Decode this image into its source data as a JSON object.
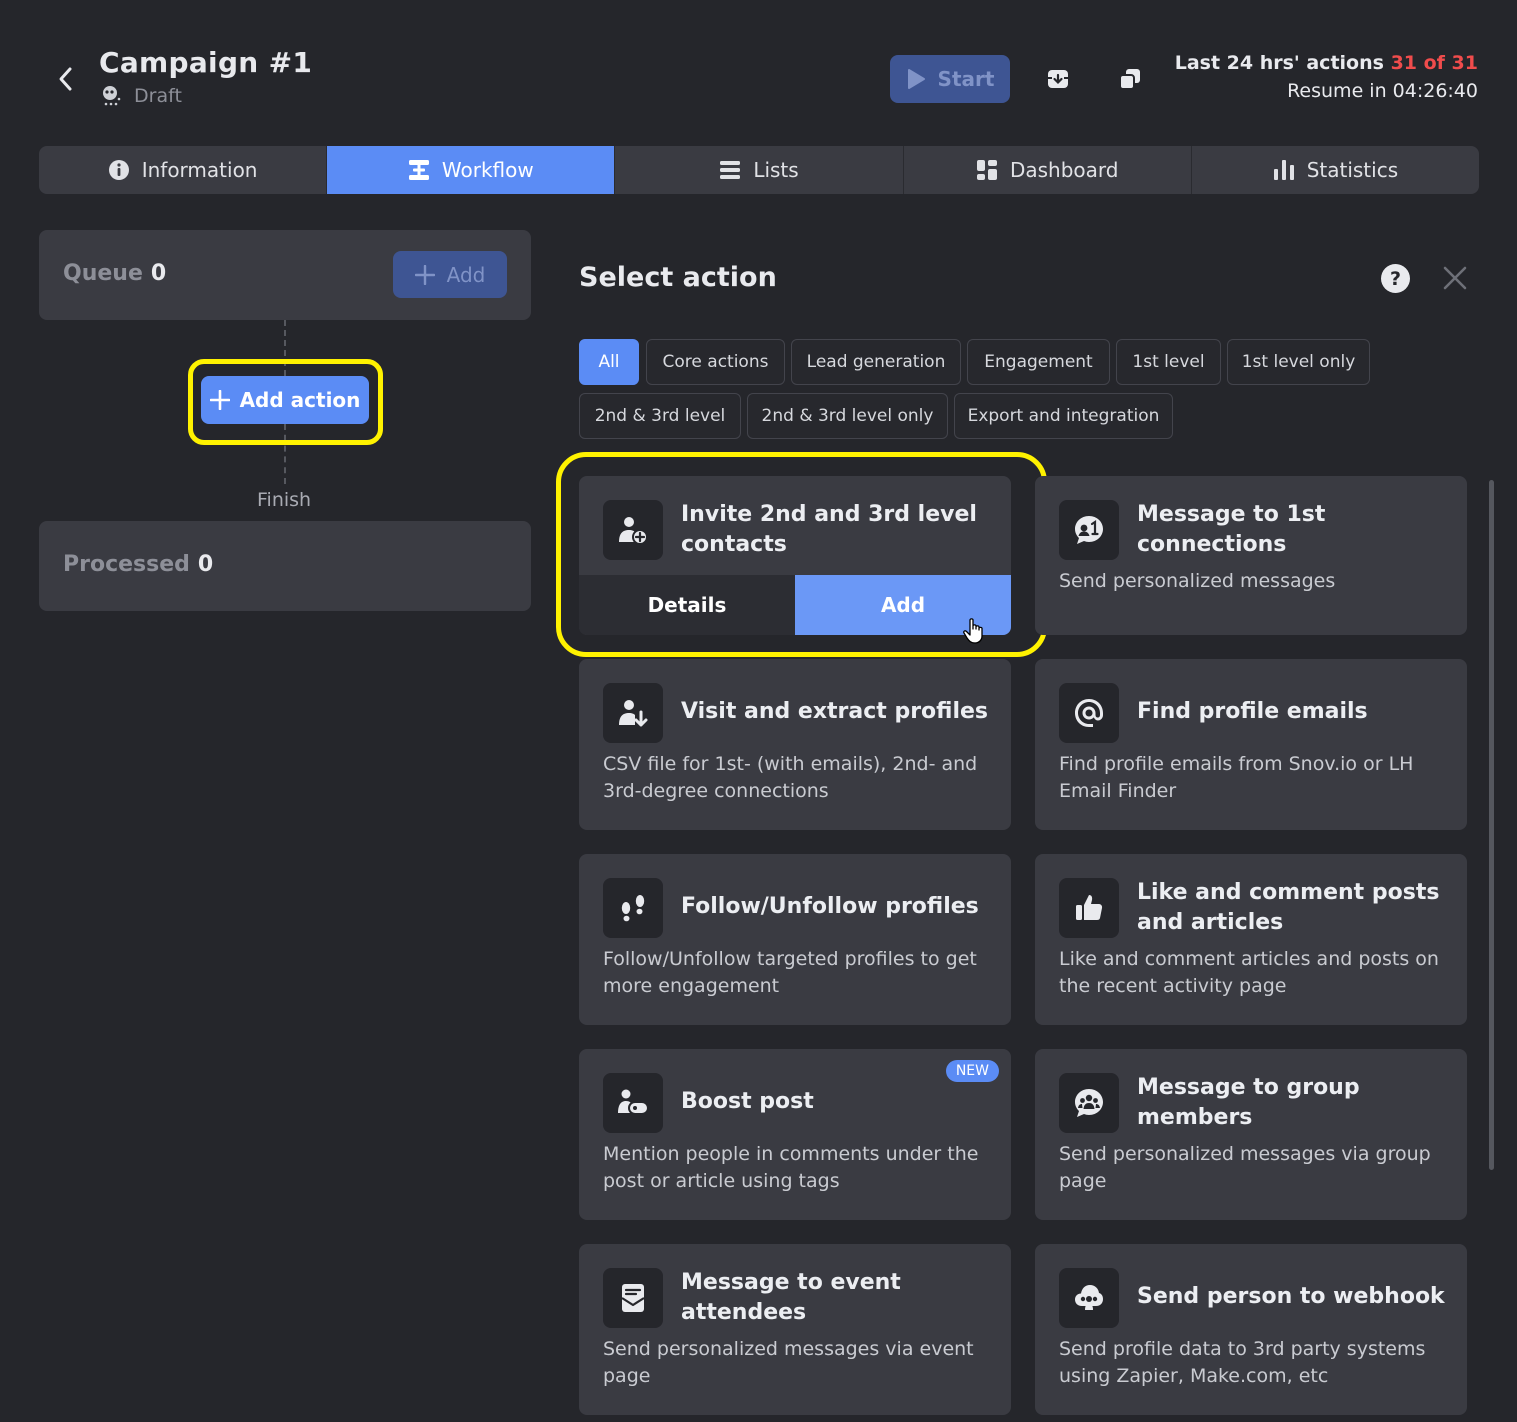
{
  "header": {
    "title": "Campaign #1",
    "status": "Draft",
    "start_label": "Start",
    "actions_prefix": "Last 24 hrs' actions",
    "actions_count": "31 of 31",
    "resume": "Resume in 04:26:40"
  },
  "tabs": [
    {
      "label": "Information",
      "icon": "info-icon"
    },
    {
      "label": "Workflow",
      "icon": "workflow-icon",
      "active": true
    },
    {
      "label": "Lists",
      "icon": "list-icon"
    },
    {
      "label": "Dashboard",
      "icon": "dashboard-icon"
    },
    {
      "label": "Statistics",
      "icon": "bar-chart-icon"
    }
  ],
  "workflow": {
    "queue_label": "Queue",
    "queue_count": "0",
    "queue_add": "Add",
    "add_action": "Add action",
    "finish": "Finish",
    "processed_label": "Processed",
    "processed_count": "0"
  },
  "panel": {
    "title": "Select action",
    "help": "?",
    "filters": [
      "All",
      "Core actions",
      "Lead generation",
      "Engagement",
      "1st level",
      "1st level only",
      "2nd & 3rd level",
      "2nd & 3rd level only",
      "Export and integration"
    ],
    "active_filter": "All",
    "cards": [
      {
        "title": "Invite 2nd and 3rd level contacts",
        "desc": "",
        "icon": "user-plus-icon",
        "details_label": "Details",
        "add_label": "Add"
      },
      {
        "title": "Message to 1st connections",
        "desc": "Send personalized messages",
        "icon": "chat-icon"
      },
      {
        "title": "Visit and extract profiles",
        "desc": "CSV file for 1st- (with emails), 2nd- and 3rd-degree connections",
        "icon": "user-download-icon"
      },
      {
        "title": "Find profile emails",
        "desc": "Find profile emails from Snov.io or LH Email Finder",
        "icon": "at-sign-icon"
      },
      {
        "title": "Follow/Unfollow profiles",
        "desc": "Follow/Unfollow targeted profiles to get more engagement",
        "icon": "footprints-icon"
      },
      {
        "title": "Like and comment posts and articles",
        "desc": "Like and comment articles and posts on the recent activity page",
        "icon": "thumbs-up-icon"
      },
      {
        "title": "Boost post",
        "desc": "Mention people in comments under the post or article using tags",
        "icon": "user-tag-icon",
        "badge": "NEW"
      },
      {
        "title": "Message to group members",
        "desc": "Send personalized messages via group page",
        "icon": "group-chat-icon"
      },
      {
        "title": "Message to event attendees",
        "desc": "Send personalized messages via event page",
        "icon": "event-mail-icon"
      },
      {
        "title": "Send person to webhook",
        "desc": "Send profile data to 3rd party systems using Zapier, Make.com, etc",
        "icon": "webhook-icon"
      }
    ]
  },
  "colors": {
    "background": "#25262b",
    "card": "#3a3b42",
    "accent": "#5b8cf5",
    "highlight": "#fff200",
    "danger": "#f04c4c"
  }
}
